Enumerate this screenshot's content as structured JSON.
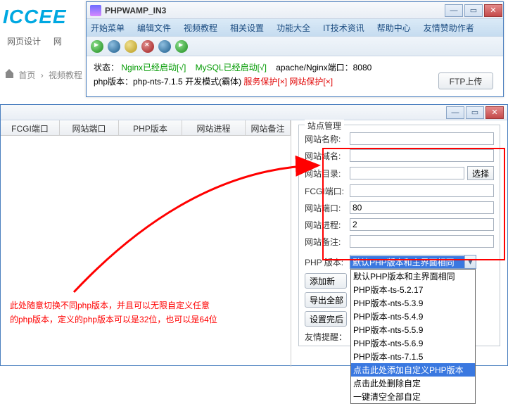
{
  "bg": {
    "logo": "ICCEE",
    "nav": [
      "网页设计",
      "网"
    ],
    "crumb": [
      "首页",
      "视频教程"
    ]
  },
  "app": {
    "title": "PHPWAMP_IN3",
    "menu": [
      "开始菜单",
      "编辑文件",
      "视频教程",
      "相关设置",
      "功能大全",
      "IT技术资讯",
      "帮助中心",
      "友情赞助作者"
    ],
    "status_line1_a": "状态：",
    "status_line1_b": "Nginx已经启动[√]",
    "status_line1_c": "MySQL已经启动[√]",
    "status_line1_d": "apache/Nginx端口：8080",
    "status_line2_a": "php版本：php-nts-7.1.5 开发模式(霸体) ",
    "status_line2_b": "服务保护[×] 网站保护[×]",
    "ftp_btn": "FTP上传"
  },
  "list_headers": [
    "FCGI端口",
    "网站端口",
    "PHP版本",
    "网站进程",
    "网站备注"
  ],
  "form": {
    "legend": "站点管理",
    "labels": {
      "name": "网站名称:",
      "domain": "网站域名:",
      "dir": "网站目录:",
      "fcgi": "FCGI端口:",
      "port": "网站端口:",
      "proc": "网站进程:",
      "remark": "网站备注:",
      "phpver": "PHP 版本:"
    },
    "values": {
      "port": "80",
      "proc": "2"
    },
    "select_btn": "选择",
    "dd_selected": "默认PHP版本和主界面相同",
    "dd_options": [
      "默认PHP版本和主界面相同",
      "PHP版本-ts-5.2.17",
      "PHP版本-nts-5.3.9",
      "PHP版本-nts-5.4.9",
      "PHP版本-nts-5.5.9",
      "PHP版本-nts-5.6.9",
      "PHP版本-nts-7.1.5",
      "点击此处添加自定义PHP版本",
      "点击此处删除自定",
      "一键清空全部自定"
    ],
    "act_btns": [
      "添加新",
      "导出全部",
      "设置完后"
    ],
    "hint": "友情提醒："
  },
  "annotation_l1": "此处随意切换不同php版本，并且可以无限自定义任意",
  "annotation_l2": "的php版本，定义的php版本可以是32位，也可以是64位"
}
